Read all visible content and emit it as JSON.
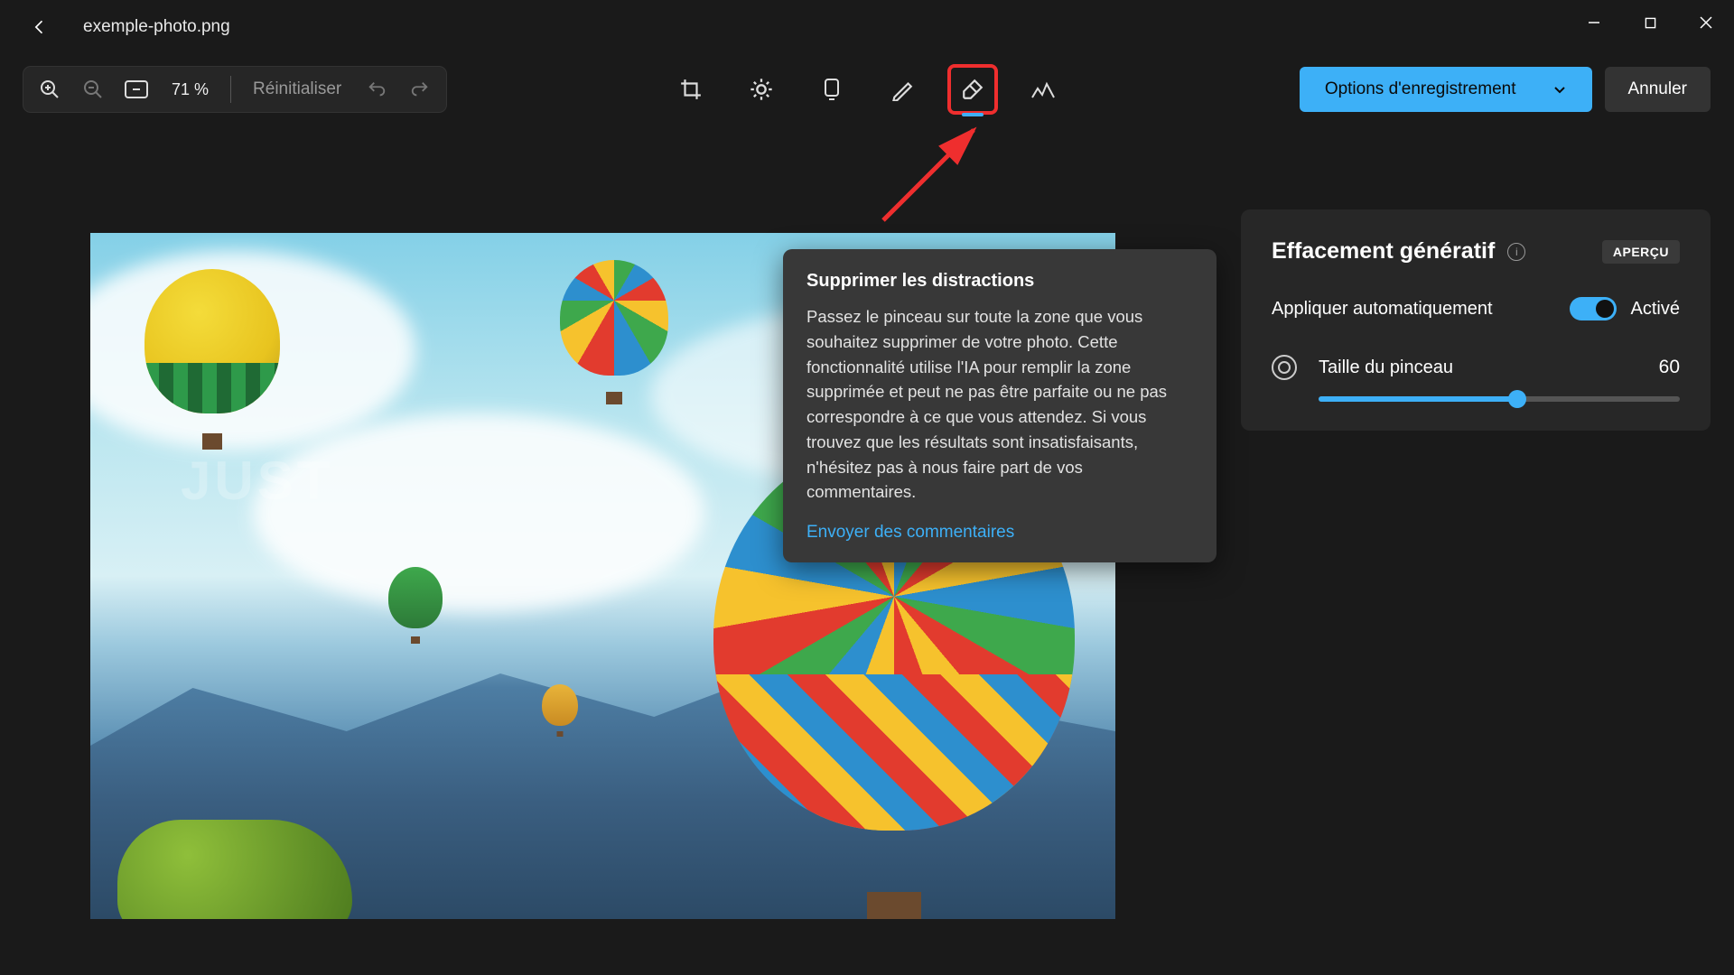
{
  "titlebar": {
    "filename": "exemple-photo.png"
  },
  "toolbar": {
    "zoom_percent": "71 %",
    "reset_label": "Réinitialiser",
    "save_options": "Options d'enregistrement",
    "cancel": "Annuler"
  },
  "tooltip": {
    "title": "Supprimer les distractions",
    "body": "Passez le pinceau sur toute la zone que vous souhaitez supprimer de votre photo. Cette fonctionnalité utilise l'IA pour remplir la zone supprimée et peut ne pas être parfaite ou ne pas correspondre à ce que vous attendez. Si vous trouvez que les résultats sont insatisfaisants, n'hésitez pas à nous faire part de vos commentaires.",
    "link": "Envoyer des commentaires"
  },
  "panel": {
    "title": "Effacement génératif",
    "badge": "APERÇU",
    "auto_apply_label": "Appliquer automatiquement",
    "toggle_state": "Activé",
    "brush_size_label": "Taille du pinceau",
    "brush_size_value": "60",
    "brush_size_pct": 55
  },
  "annotation": {
    "highlight_color": "#ef2e2e"
  }
}
